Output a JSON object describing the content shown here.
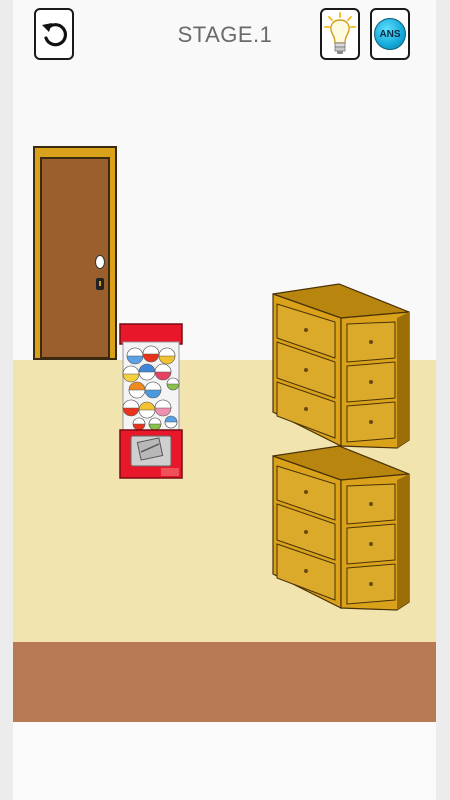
{
  "header": {
    "stage_title": "STAGE.1",
    "restart_icon": "restart-arrow-icon",
    "hint_icon": "lightbulb-icon",
    "answer_label": "ANS"
  },
  "scene": {
    "objects": [
      "door",
      "gumball-machine",
      "drawer-chest-top",
      "drawer-chest-bottom"
    ]
  },
  "colors": {
    "wall": "#f9f9f9",
    "floor": "#f2e4ae",
    "baseboard": "#b77a55",
    "door_wood": "#9a5f2c",
    "door_frame": "#d9a21a",
    "chest_wood": "#d9a21a",
    "gumball_machine_red": "#e8182a"
  }
}
